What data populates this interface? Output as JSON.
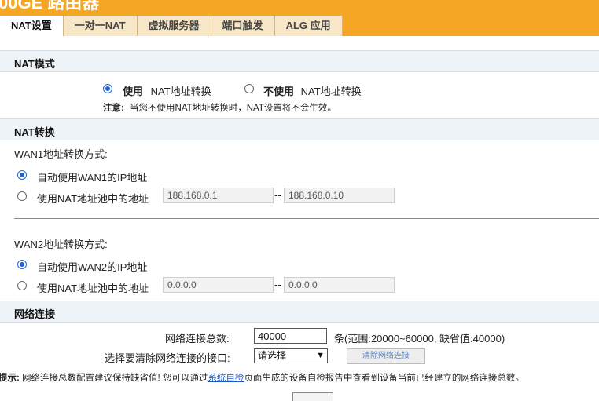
{
  "header": {
    "title": "00GE 路由器"
  },
  "tabs": [
    {
      "label": "NAT设置",
      "active": true
    },
    {
      "label": "一对一NAT",
      "active": false
    },
    {
      "label": "虚拟服务器",
      "active": false
    },
    {
      "label": "端口触发",
      "active": false
    },
    {
      "label": "ALG 应用",
      "active": false
    }
  ],
  "nat_mode": {
    "heading": "NAT模式",
    "option_use_bold": "使用",
    "option_use_rest": "NAT地址转换",
    "option_nouse_bold": "不使用",
    "option_nouse_rest": "NAT地址转换",
    "selected": "use",
    "note_label": "注意:",
    "note_text": "当您不使用NAT地址转换时，NAT设置将不会生效。"
  },
  "nat_convert": {
    "heading": "NAT转换",
    "wan1": {
      "label": "WAN1地址转换方式:",
      "auto_label": "自动使用WAN1的IP地址",
      "pool_label": "使用NAT地址池中的地址",
      "pool_start": "188.168.0.1",
      "pool_end": "188.168.0.10",
      "separator": "--",
      "selected": "auto"
    },
    "wan2": {
      "label": "WAN2地址转换方式:",
      "auto_label": "自动使用WAN2的IP地址",
      "pool_label": "使用NAT地址池中的地址",
      "pool_start": "0.0.0.0",
      "pool_end": "0.0.0.0",
      "separator": "--",
      "selected": "auto"
    }
  },
  "net_conn": {
    "heading": "网络连接",
    "total_label": "网络连接总数:",
    "total_value": "40000",
    "total_hint": "条(范围:20000~60000, 缺省值:40000)",
    "iface_label": "选择要清除网络连接的接口:",
    "iface_selected": "请选择",
    "clear_button": "清除网络连接"
  },
  "tip": {
    "label": "提示:",
    "text_before": "网络连接总数配置建议保持缺省值! 您可以通过",
    "link": "系统自检",
    "text_after": "页面生成的设备自检报告中查看到设备当前已经建立的网络连接总数。"
  },
  "colors": {
    "accent": "#f5a623",
    "tab_bg": "#f7e7c6",
    "section_bg": "#eef3f8",
    "radio": "#1a62d6"
  }
}
